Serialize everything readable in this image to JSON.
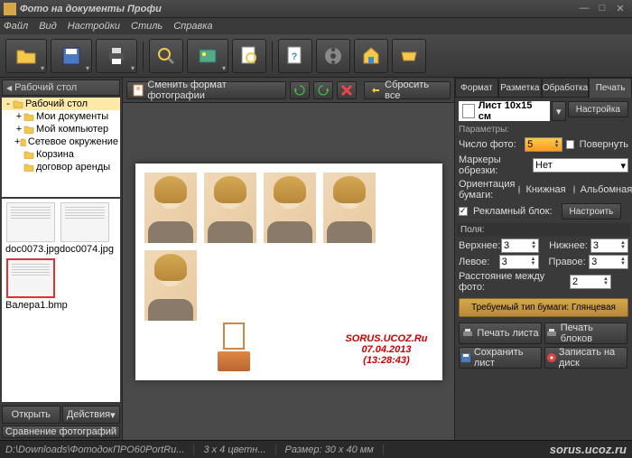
{
  "window": {
    "title": "Фото на документы Профи"
  },
  "menu": [
    "Файл",
    "Вид",
    "Настройки",
    "Стиль",
    "Справка"
  ],
  "sidebar": {
    "header": "Рабочий стол",
    "tree": [
      {
        "label": "Рабочий стол",
        "level": 0,
        "selected": true,
        "exp": "-"
      },
      {
        "label": "Мои документы",
        "level": 1,
        "exp": "+"
      },
      {
        "label": "Мой компьютер",
        "level": 1,
        "exp": "+"
      },
      {
        "label": "Сетевое окружение",
        "level": 1,
        "exp": "+"
      },
      {
        "label": "Корзина",
        "level": 1,
        "exp": ""
      },
      {
        "label": "договор аренды",
        "level": 1,
        "exp": ""
      }
    ],
    "thumbs": [
      {
        "name": "doc0073.jpg",
        "selected": false
      },
      {
        "name": "doc0074.jpg",
        "selected": false
      },
      {
        "name": "Валера1.bmp",
        "selected": true
      }
    ],
    "open_btn": "Открыть",
    "actions_btn": "Действия",
    "compare_btn": "Сравнение фотографий"
  },
  "center_toolbar": {
    "change_format": "Сменить формат фотографии",
    "reset_all": "Сбросить все"
  },
  "preview": {
    "photo_count": 5,
    "ad_lines": [
      "SORUS.UCOZ.Ru",
      "07.04.2013",
      "(13:28:43)"
    ]
  },
  "right": {
    "tabs": [
      "Формат",
      "Разметка",
      "Обработка",
      "Печать"
    ],
    "active_tab": 3,
    "format_value": "Лист 10x15 см",
    "settings_btn": "Настройка",
    "params_label": "Параметры:",
    "num_photos_label": "Число фото:",
    "num_photos": "5",
    "rotate_label": "Повернуть",
    "crop_markers_label": "Маркеры обрезки:",
    "crop_markers_value": "Нет",
    "orientation_label": "Ориентация бумаги:",
    "orientation_book": "Книжная",
    "orientation_land": "Альбомная",
    "adblock_label": "Рекламный блок:",
    "adblock_btn": "Настроить",
    "margins_label": "Поля:",
    "margin_top_label": "Верхнее:",
    "margin_top": "3",
    "margin_bottom_label": "Нижнее:",
    "margin_bottom": "3",
    "margin_left_label": "Левое:",
    "margin_left": "3",
    "margin_right_label": "Правое:",
    "margin_right": "3",
    "spacing_label": "Расстояние между фото:",
    "spacing": "2",
    "paper_req": "Требуемый тип бумаги: Глянцевая",
    "actions": {
      "print_sheet": "Печать листа",
      "print_blocks": "Печать блоков",
      "save_sheet": "Сохранить лист",
      "burn_disc": "Записать на диск"
    }
  },
  "status": {
    "path": "D:\\Downloads\\ФотодокПРО60PortRu...",
    "color": "3 x 4 цветн...",
    "size": "Размер: 30 x 40 мм",
    "brand": "sorus.ucoz.ru"
  }
}
